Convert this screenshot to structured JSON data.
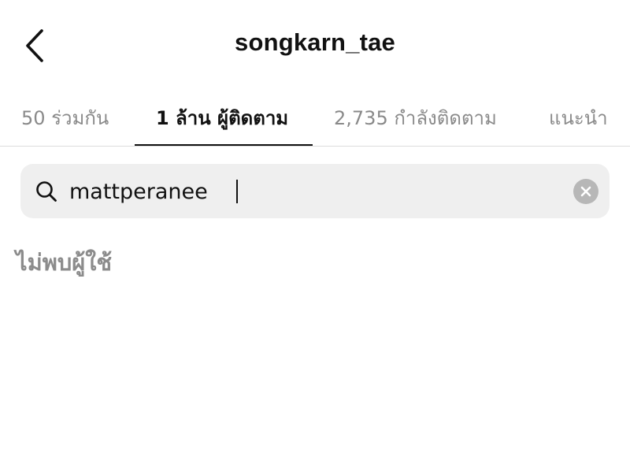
{
  "header": {
    "back_icon": "chevron-left-icon",
    "title": "songkarn_tae"
  },
  "tabs": [
    {
      "label": "50 ร่วมกัน",
      "active": false
    },
    {
      "label": "1 ล้าน ผู้ติดตาม",
      "active": true
    },
    {
      "label": "2,735 กำลังติดตาม",
      "active": false
    },
    {
      "label": "แนะนำ",
      "active": false
    }
  ],
  "search": {
    "icon": "search-icon",
    "value": "mattperanee",
    "clear_icon": "clear-icon"
  },
  "results": {
    "empty_message": "ไม่พบผู้ใช้"
  }
}
